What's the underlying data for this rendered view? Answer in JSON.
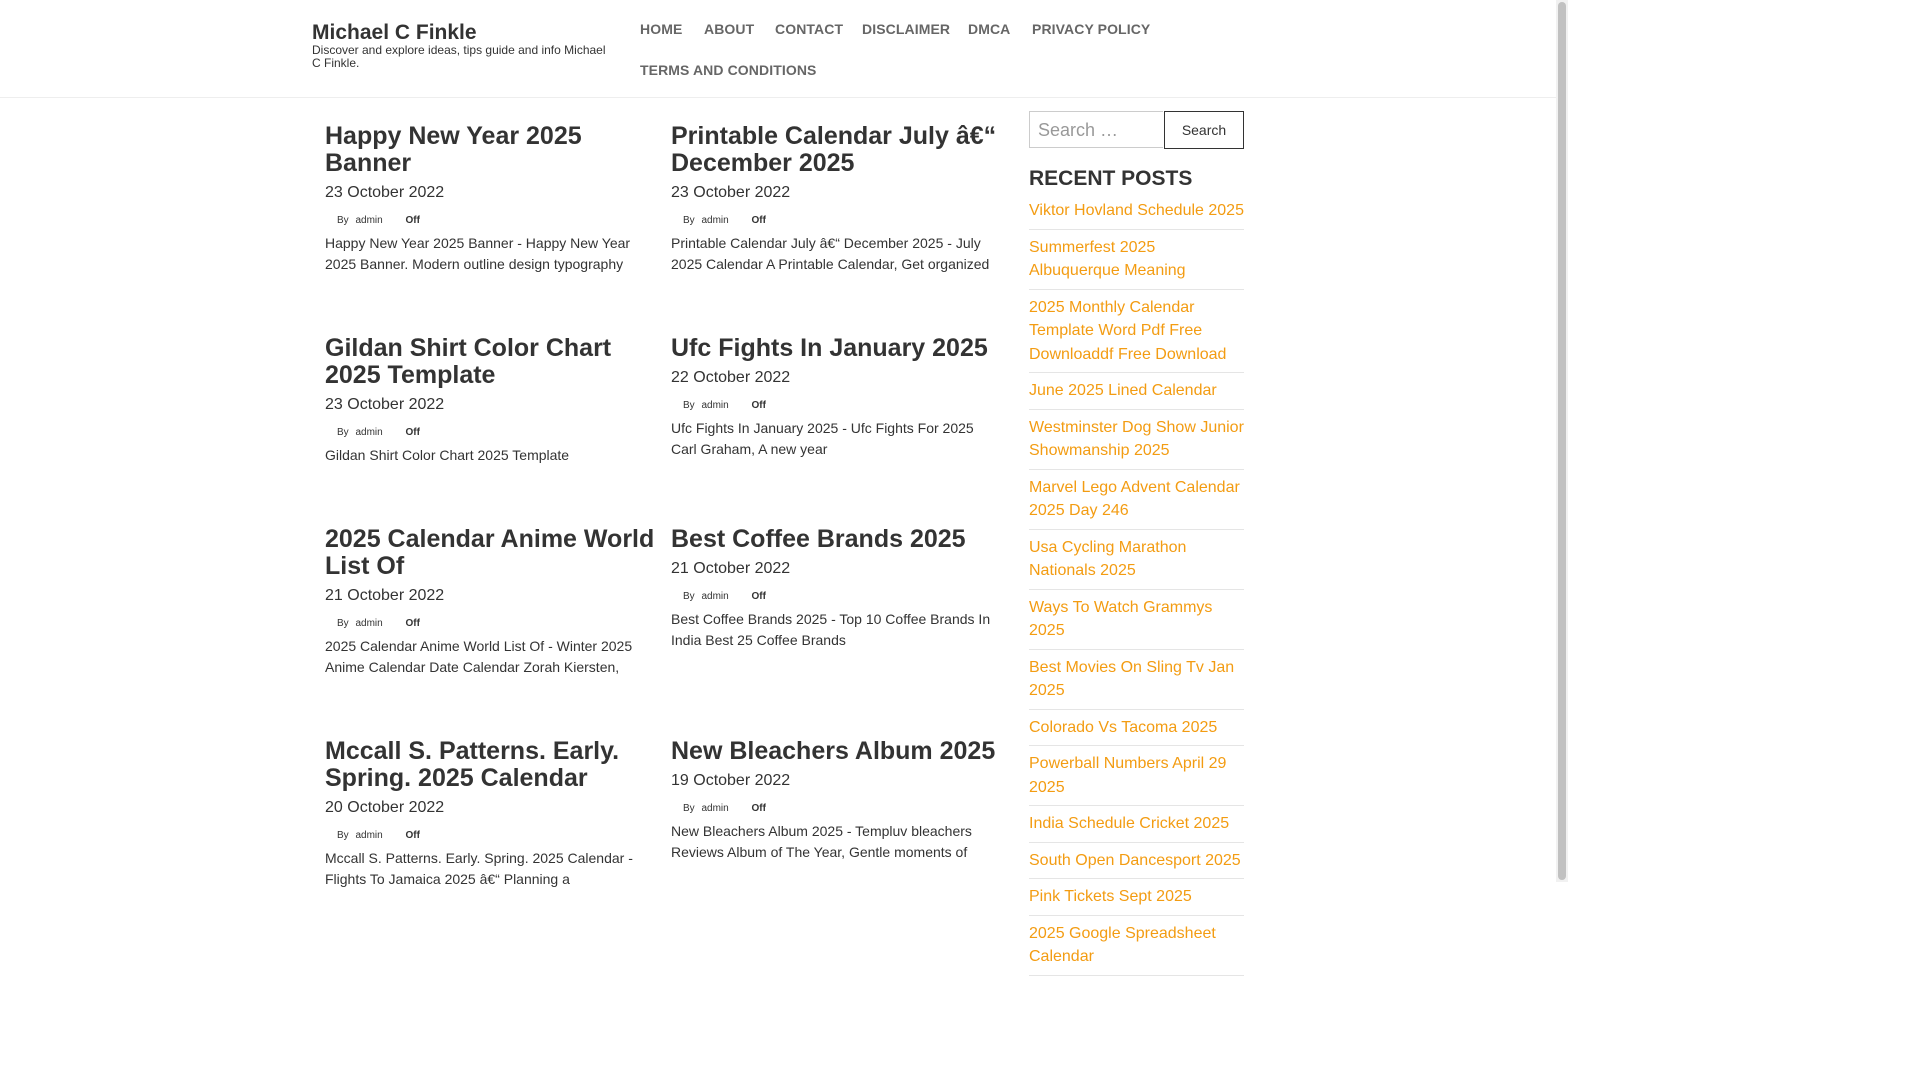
{
  "site": {
    "title": "Michael C Finkle",
    "description": "Discover and explore ideas, tips guide and info Michael C Finkle."
  },
  "nav": [
    "HOME",
    "ABOUT",
    "CONTACT",
    "DISCLAIMER",
    "DMCA",
    "PRIVACY POLICY",
    "TERMS AND CONDITIONS"
  ],
  "posts": [
    {
      "title": "Happy New Year 2025 Banner",
      "date": "23 October 2022",
      "by": "By",
      "author": "admin",
      "comments": "Off",
      "excerpt": "Happy New Year 2025 Banner - Happy New Year 2025 Banner. Modern outline design typography"
    },
    {
      "title": "Printable Calendar July â€“ December 2025",
      "date": "23 October 2022",
      "by": "By",
      "author": "admin",
      "comments": "Off",
      "excerpt": "Printable Calendar July â€“ December 2025 - July 2025 Calendar A Printable Calendar, Get organized"
    },
    {
      "title": "Gildan Shirt Color Chart 2025 Template",
      "date": "23 October 2022",
      "by": "By",
      "author": "admin",
      "comments": "Off",
      "excerpt": "Gildan Shirt Color Chart 2025 Template"
    },
    {
      "title": "Ufc Fights In January 2025",
      "date": "22 October 2022",
      "by": "By",
      "author": "admin",
      "comments": "Off",
      "excerpt": "Ufc Fights In January 2025 - Ufc Fights For 2025 Carl Graham, A new year"
    },
    {
      "title": "2025 Calendar Anime World List Of",
      "date": "21 October 2022",
      "by": "By",
      "author": "admin",
      "comments": "Off",
      "excerpt": "2025 Calendar Anime World List Of - Winter 2025 Anime Calendar Date Calendar Zorah Kiersten,"
    },
    {
      "title": "Best Coffee Brands 2025",
      "date": "21 October 2022",
      "by": "By",
      "author": "admin",
      "comments": "Off",
      "excerpt": "Best Coffee Brands 2025 - Top 10 Coffee Brands In India Best 25 Coffee Brands"
    },
    {
      "title": "Mccall S. Patterns. Early. Spring. 2025 Calendar",
      "date": "20 October 2022",
      "by": "By",
      "author": "admin",
      "comments": "Off",
      "excerpt": "Mccall S. Patterns. Early. Spring. 2025 Calendar - Flights To Jamaica 2025 â€“ Planning a"
    },
    {
      "title": "New Bleachers Album 2025",
      "date": "19 October 2022",
      "by": "By",
      "author": "admin",
      "comments": "Off",
      "excerpt": "New Bleachers Album 2025 - Templuv bleachers Reviews Album of The Year, Gentle moments of"
    }
  ],
  "search": {
    "placeholder": "Search …",
    "button_label": "Search"
  },
  "recent_posts": {
    "title": "RECENT POSTS",
    "items": [
      "Viktor Hovland Schedule 2025",
      "Summerfest 2025 Albuquerque Meaning",
      "2025 Monthly Calendar Template Word Pdf Free Downloaddf Free Download",
      "June 2025 Lined Calendar",
      "Westminster Dog Show Junior Showmanship 2025",
      "Marvel Lego Advent Calendar 2025 Day 246",
      "Usa Cycling Marathon Nationals 2025",
      "Ways To Watch Grammys 2025",
      "Best Movies On Sling Tv Jan 2025",
      "Colorado Vs Tacoma 2025",
      "Powerball Numbers April 29 2025",
      "India Schedule Cricket 2025",
      "South Open Dancesport 2025",
      "Pink Tickets Sept 2025",
      "2025 Google Spreadsheet Calendar"
    ]
  },
  "colors": {
    "link_accent": "#f39c12",
    "nav_text": "#666666",
    "text": "#333333"
  }
}
